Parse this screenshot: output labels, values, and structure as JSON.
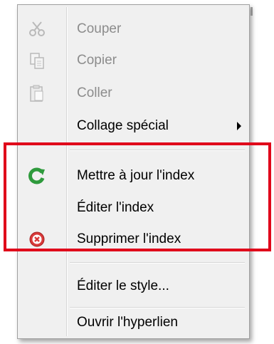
{
  "menu": {
    "items": [
      {
        "label": "Couper",
        "icon": "scissors-icon",
        "disabled": true
      },
      {
        "label": "Copier",
        "icon": "copy-icon",
        "disabled": true
      },
      {
        "label": "Coller",
        "icon": "paste-icon",
        "disabled": true
      },
      {
        "label": "Collage spécial",
        "icon": "",
        "disabled": false,
        "submenu": true
      },
      {
        "label": "Mettre à jour l'index",
        "icon": "refresh-icon",
        "disabled": false
      },
      {
        "label": "Éditer l'index",
        "icon": "",
        "disabled": false
      },
      {
        "label": "Supprimer l'index",
        "icon": "delete-circle-icon",
        "disabled": false
      },
      {
        "label": "Éditer le style...",
        "icon": "",
        "disabled": false
      },
      {
        "label": "Ouvrir l'hyperlien",
        "icon": "",
        "disabled": false
      }
    ]
  },
  "colors": {
    "highlight_border": "#e0001a",
    "refresh_icon": "#2e9a3c",
    "delete_icon": "#d83a3a",
    "disabled_text": "#8c8c8c"
  }
}
